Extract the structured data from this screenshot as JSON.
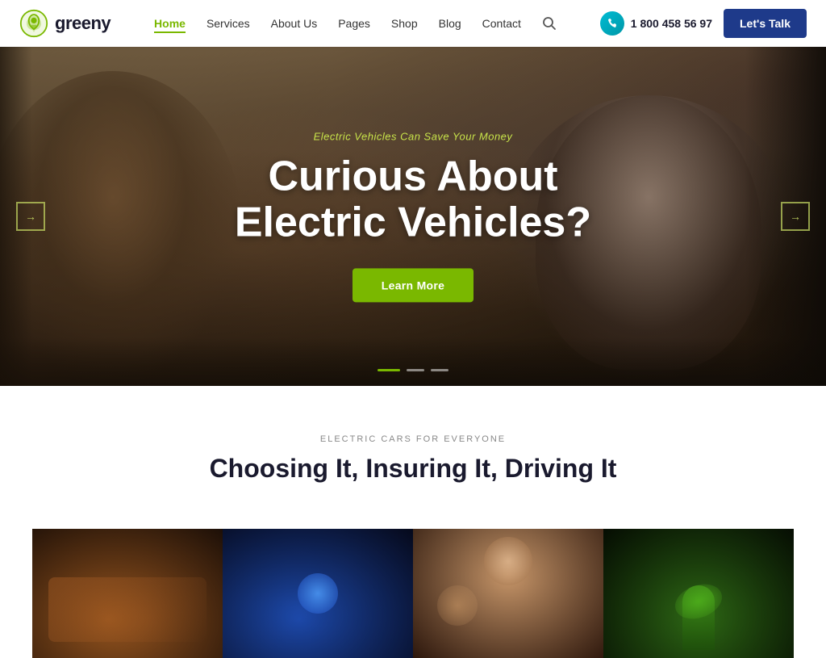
{
  "header": {
    "logo_text": "greeny",
    "nav_items": [
      {
        "label": "Home",
        "active": true
      },
      {
        "label": "Services",
        "active": false
      },
      {
        "label": "About Us",
        "active": false
      },
      {
        "label": "Pages",
        "active": false
      },
      {
        "label": "Shop",
        "active": false
      },
      {
        "label": "Blog",
        "active": false
      },
      {
        "label": "Contact",
        "active": false
      }
    ],
    "phone": "1 800 458 56 97",
    "cta_label": "Let's Talk"
  },
  "hero": {
    "subtitle": "Electric Vehicles Can Save Your Money",
    "title_line1": "Curious About",
    "title_line2": "Electric Vehicles?",
    "btn_label": "Learn More",
    "arrow_left": "←",
    "arrow_right": "→"
  },
  "section": {
    "eyebrow": "ELECTRIC CARS FOR EVERYONE",
    "title": "Choosing It, Insuring It, Driving It"
  },
  "cards": [
    {
      "id": 1,
      "alt": "Car interior"
    },
    {
      "id": 2,
      "alt": "EV charger"
    },
    {
      "id": 3,
      "alt": "People in car"
    },
    {
      "id": 4,
      "alt": "Green plant"
    }
  ]
}
